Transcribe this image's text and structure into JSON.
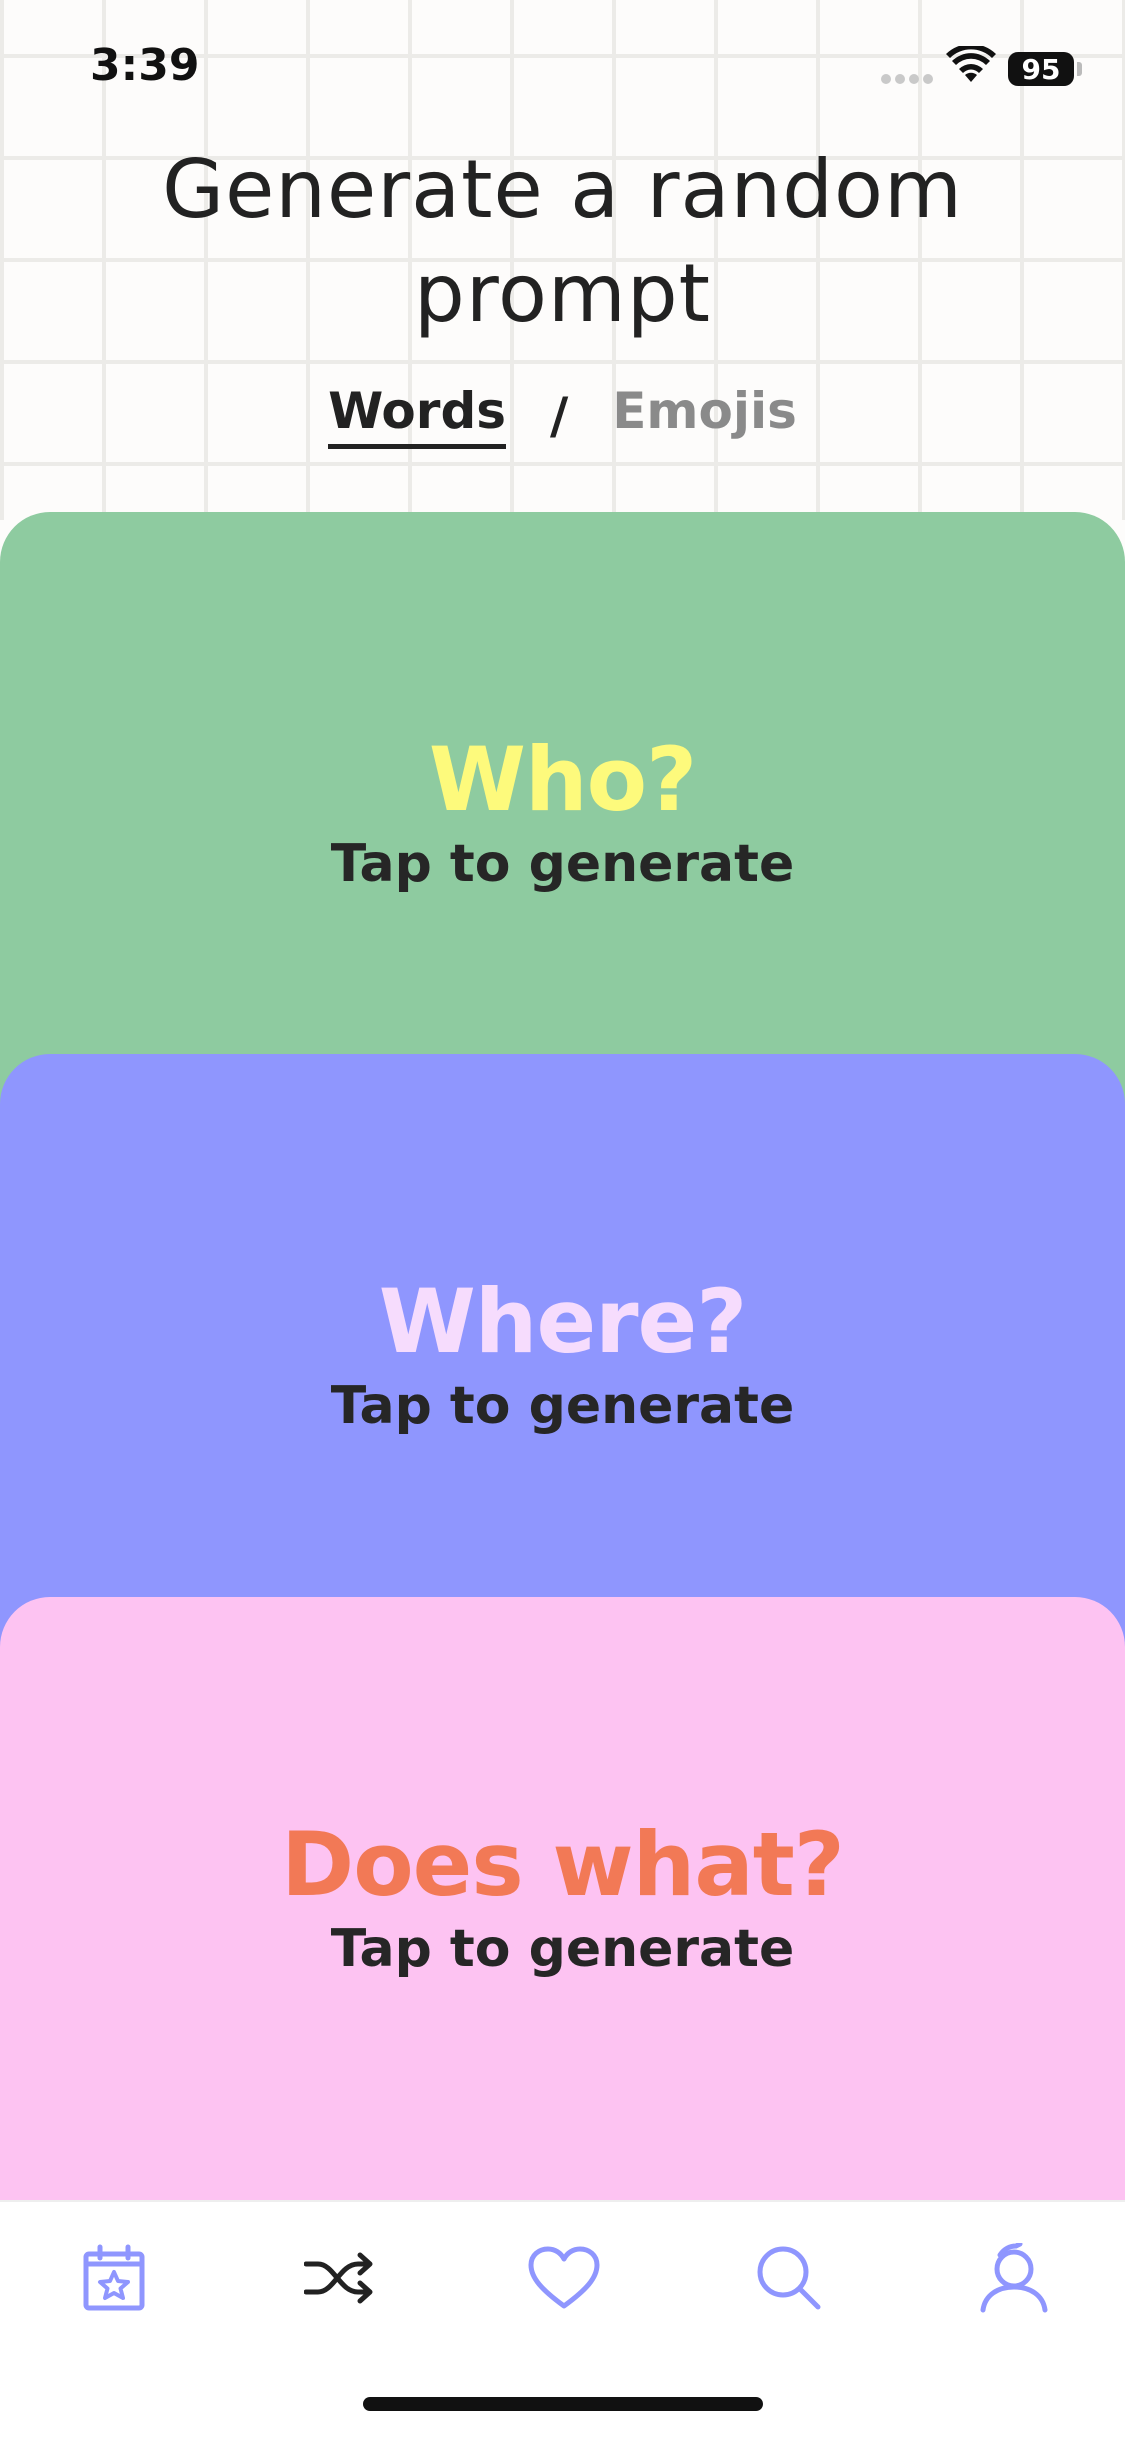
{
  "status_bar": {
    "time": "3:39",
    "battery": "95"
  },
  "header": {
    "title_line1": "Generate a random",
    "title_line2": "prompt"
  },
  "mode_switch": {
    "words_label": "Words",
    "separator": "/",
    "emojis_label": "Emojis",
    "selected": "Words"
  },
  "cards": [
    {
      "question": "Who?",
      "hint": "Tap to generate",
      "bg": "#8ecba0",
      "accent": "#fdfa7c"
    },
    {
      "question": "Where?",
      "hint": "Tap to generate",
      "bg": "#8f96fe",
      "accent": "#f6dcfd"
    },
    {
      "question": "Does what?",
      "hint": "Tap to generate",
      "bg": "#fdc3f2",
      "accent": "#f27956"
    }
  ],
  "tab_bar": {
    "items": [
      {
        "icon": "calendar-star-icon",
        "active": false
      },
      {
        "icon": "shuffle-icon",
        "active": true
      },
      {
        "icon": "heart-icon",
        "active": false
      },
      {
        "icon": "search-icon",
        "active": false
      },
      {
        "icon": "profile-icon",
        "active": false
      }
    ],
    "icon_color": "#8f96fe",
    "active_color": "#222222"
  }
}
